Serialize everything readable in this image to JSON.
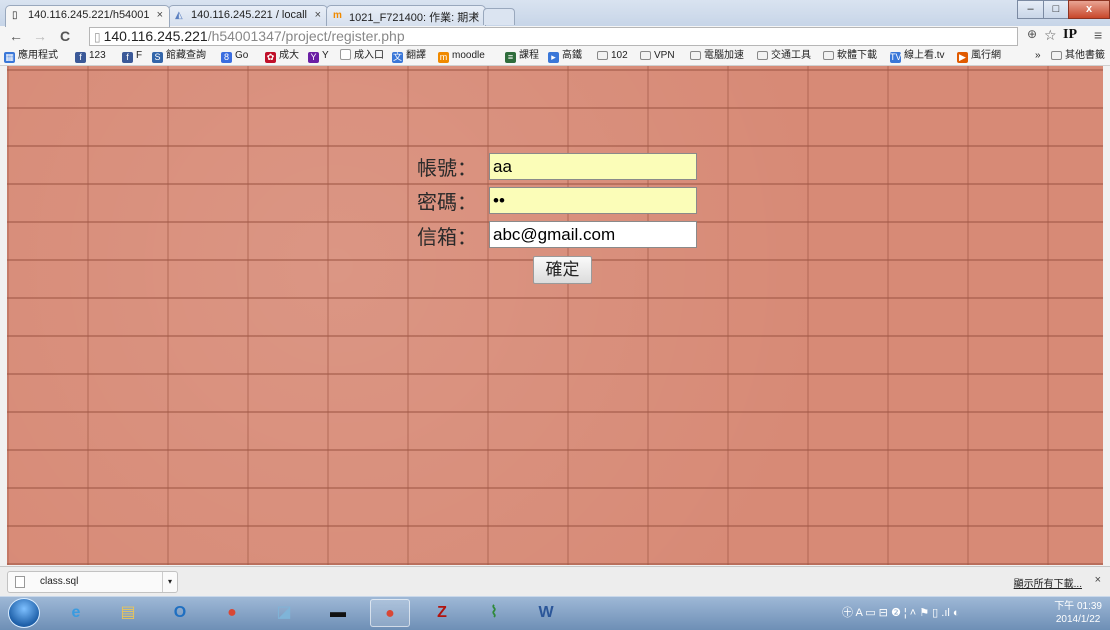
{
  "tabs": [
    {
      "title": "140.116.245.221/h54001",
      "icon": "page-icon",
      "close": "×"
    },
    {
      "title": "140.116.245.221 / locall",
      "icon": "phpmyadmin-icon",
      "close": "×"
    },
    {
      "title": "1021_F721400: 作業: 期末",
      "icon": "moodle-icon",
      "close": "×"
    }
  ],
  "window_controls": {
    "minimize": "–",
    "maximize": "□",
    "close": "x"
  },
  "address_bar": {
    "host": "140.116.245.221",
    "path": "/h54001347/project/register.php",
    "back": "←",
    "forward": "→",
    "reload": "C",
    "zoom": "⊕",
    "star": "☆",
    "ext": "IP",
    "menu": "≡"
  },
  "bookmarks": [
    {
      "label": "應用程式",
      "icon": "apps-icon",
      "color": "#3a77d8"
    },
    {
      "label": "123",
      "icon": "facebook-icon",
      "color": "#3b5998"
    },
    {
      "label": "F",
      "icon": "facebook-icon",
      "color": "#3b5998"
    },
    {
      "label": "館藏查詢",
      "icon": "library-icon",
      "color": "#3366aa"
    },
    {
      "label": "Go",
      "icon": "google-icon",
      "color": "#3a6de0"
    },
    {
      "label": "成大",
      "icon": "ncku-icon",
      "color": "#c0102a"
    },
    {
      "label": "Y",
      "icon": "yahoo-icon",
      "color": "#6b1fa5"
    },
    {
      "label": "成入口",
      "icon": "page-icon",
      "color": "#ffffff"
    },
    {
      "label": "翻譯",
      "icon": "translate-icon",
      "color": "#3a77d8"
    },
    {
      "label": "moodle",
      "icon": "moodle-icon",
      "color": "#f08a00"
    },
    {
      "label": "課程",
      "icon": "course-icon",
      "color": "#2f6d3c"
    },
    {
      "label": "高鐵",
      "icon": "train-icon",
      "color": "#3a77d8"
    },
    {
      "label": "102",
      "icon": "folder-icon",
      "color": "#ffffff"
    },
    {
      "label": "VPN",
      "icon": "folder-icon",
      "color": "#ffffff"
    },
    {
      "label": "電腦加速",
      "icon": "folder-icon",
      "color": "#ffffff"
    },
    {
      "label": "交通工具",
      "icon": "folder-icon",
      "color": "#ffffff"
    },
    {
      "label": "軟體下載",
      "icon": "folder-icon",
      "color": "#ffffff"
    },
    {
      "label": "線上看.tv",
      "icon": "tv-icon",
      "color": "#3a77d8"
    },
    {
      "label": "風行網",
      "icon": "fengxing-icon",
      "color": "#e05a00"
    }
  ],
  "bookmarks_overflow": "»",
  "bookmarks_other": "其他書籤",
  "form": {
    "account_label": "帳號：",
    "account_value": "aa",
    "password_label": "密碼：",
    "password_value": "••",
    "email_label": "信箱：",
    "email_value": "abc@gmail.com",
    "submit_label": "確定"
  },
  "download_shelf": {
    "file_name": "class.sql",
    "show_all": "顯示所有下載...",
    "close": "×"
  },
  "taskbar": {
    "apps": [
      {
        "name": "ie-icon",
        "glyph": "e",
        "color": "#3a9be0"
      },
      {
        "name": "explorer-icon",
        "glyph": "▤",
        "color": "#e8c45a"
      },
      {
        "name": "outlook-icon",
        "glyph": "O",
        "color": "#1f6fc1"
      },
      {
        "name": "chrome-icon",
        "glyph": "●",
        "color": "#d94735"
      },
      {
        "name": "notes-icon",
        "glyph": "◪",
        "color": "#7fb4d8"
      },
      {
        "name": "cmd-icon",
        "glyph": "▬",
        "color": "#111111"
      },
      {
        "name": "chrome-active-icon",
        "glyph": "●",
        "color": "#d94735"
      },
      {
        "name": "filezilla-icon",
        "glyph": "Z",
        "color": "#b1140f"
      },
      {
        "name": "chart-app-icon",
        "glyph": "⌇",
        "color": "#2f8a3a"
      },
      {
        "name": "word-icon",
        "glyph": "W",
        "color": "#2b5699"
      }
    ],
    "tray_icons": "㊉ A ▭ ⊟ ❷ ¦ ˄ ⚑ ▯ .ıl ◐",
    "time": "下午 01:39",
    "date": "2014/1/22"
  }
}
